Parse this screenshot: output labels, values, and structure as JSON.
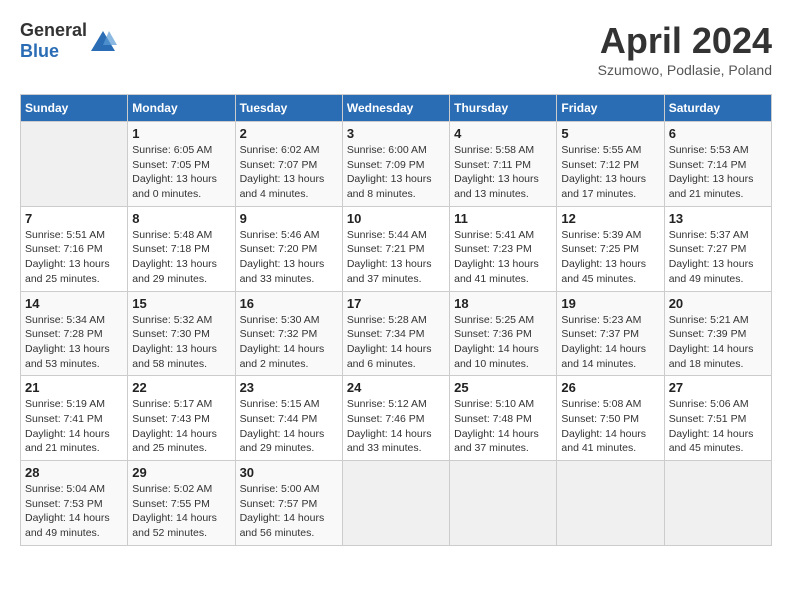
{
  "header": {
    "logo_general": "General",
    "logo_blue": "Blue",
    "title": "April 2024",
    "subtitle": "Szumowo, Podlasie, Poland"
  },
  "days_of_week": [
    "Sunday",
    "Monday",
    "Tuesday",
    "Wednesday",
    "Thursday",
    "Friday",
    "Saturday"
  ],
  "weeks": [
    [
      {
        "day": "",
        "info": ""
      },
      {
        "day": "1",
        "info": "Sunrise: 6:05 AM\nSunset: 7:05 PM\nDaylight: 13 hours\nand 0 minutes."
      },
      {
        "day": "2",
        "info": "Sunrise: 6:02 AM\nSunset: 7:07 PM\nDaylight: 13 hours\nand 4 minutes."
      },
      {
        "day": "3",
        "info": "Sunrise: 6:00 AM\nSunset: 7:09 PM\nDaylight: 13 hours\nand 8 minutes."
      },
      {
        "day": "4",
        "info": "Sunrise: 5:58 AM\nSunset: 7:11 PM\nDaylight: 13 hours\nand 13 minutes."
      },
      {
        "day": "5",
        "info": "Sunrise: 5:55 AM\nSunset: 7:12 PM\nDaylight: 13 hours\nand 17 minutes."
      },
      {
        "day": "6",
        "info": "Sunrise: 5:53 AM\nSunset: 7:14 PM\nDaylight: 13 hours\nand 21 minutes."
      }
    ],
    [
      {
        "day": "7",
        "info": "Sunrise: 5:51 AM\nSunset: 7:16 PM\nDaylight: 13 hours\nand 25 minutes."
      },
      {
        "day": "8",
        "info": "Sunrise: 5:48 AM\nSunset: 7:18 PM\nDaylight: 13 hours\nand 29 minutes."
      },
      {
        "day": "9",
        "info": "Sunrise: 5:46 AM\nSunset: 7:20 PM\nDaylight: 13 hours\nand 33 minutes."
      },
      {
        "day": "10",
        "info": "Sunrise: 5:44 AM\nSunset: 7:21 PM\nDaylight: 13 hours\nand 37 minutes."
      },
      {
        "day": "11",
        "info": "Sunrise: 5:41 AM\nSunset: 7:23 PM\nDaylight: 13 hours\nand 41 minutes."
      },
      {
        "day": "12",
        "info": "Sunrise: 5:39 AM\nSunset: 7:25 PM\nDaylight: 13 hours\nand 45 minutes."
      },
      {
        "day": "13",
        "info": "Sunrise: 5:37 AM\nSunset: 7:27 PM\nDaylight: 13 hours\nand 49 minutes."
      }
    ],
    [
      {
        "day": "14",
        "info": "Sunrise: 5:34 AM\nSunset: 7:28 PM\nDaylight: 13 hours\nand 53 minutes."
      },
      {
        "day": "15",
        "info": "Sunrise: 5:32 AM\nSunset: 7:30 PM\nDaylight: 13 hours\nand 58 minutes."
      },
      {
        "day": "16",
        "info": "Sunrise: 5:30 AM\nSunset: 7:32 PM\nDaylight: 14 hours\nand 2 minutes."
      },
      {
        "day": "17",
        "info": "Sunrise: 5:28 AM\nSunset: 7:34 PM\nDaylight: 14 hours\nand 6 minutes."
      },
      {
        "day": "18",
        "info": "Sunrise: 5:25 AM\nSunset: 7:36 PM\nDaylight: 14 hours\nand 10 minutes."
      },
      {
        "day": "19",
        "info": "Sunrise: 5:23 AM\nSunset: 7:37 PM\nDaylight: 14 hours\nand 14 minutes."
      },
      {
        "day": "20",
        "info": "Sunrise: 5:21 AM\nSunset: 7:39 PM\nDaylight: 14 hours\nand 18 minutes."
      }
    ],
    [
      {
        "day": "21",
        "info": "Sunrise: 5:19 AM\nSunset: 7:41 PM\nDaylight: 14 hours\nand 21 minutes."
      },
      {
        "day": "22",
        "info": "Sunrise: 5:17 AM\nSunset: 7:43 PM\nDaylight: 14 hours\nand 25 minutes."
      },
      {
        "day": "23",
        "info": "Sunrise: 5:15 AM\nSunset: 7:44 PM\nDaylight: 14 hours\nand 29 minutes."
      },
      {
        "day": "24",
        "info": "Sunrise: 5:12 AM\nSunset: 7:46 PM\nDaylight: 14 hours\nand 33 minutes."
      },
      {
        "day": "25",
        "info": "Sunrise: 5:10 AM\nSunset: 7:48 PM\nDaylight: 14 hours\nand 37 minutes."
      },
      {
        "day": "26",
        "info": "Sunrise: 5:08 AM\nSunset: 7:50 PM\nDaylight: 14 hours\nand 41 minutes."
      },
      {
        "day": "27",
        "info": "Sunrise: 5:06 AM\nSunset: 7:51 PM\nDaylight: 14 hours\nand 45 minutes."
      }
    ],
    [
      {
        "day": "28",
        "info": "Sunrise: 5:04 AM\nSunset: 7:53 PM\nDaylight: 14 hours\nand 49 minutes."
      },
      {
        "day": "29",
        "info": "Sunrise: 5:02 AM\nSunset: 7:55 PM\nDaylight: 14 hours\nand 52 minutes."
      },
      {
        "day": "30",
        "info": "Sunrise: 5:00 AM\nSunset: 7:57 PM\nDaylight: 14 hours\nand 56 minutes."
      },
      {
        "day": "",
        "info": ""
      },
      {
        "day": "",
        "info": ""
      },
      {
        "day": "",
        "info": ""
      },
      {
        "day": "",
        "info": ""
      }
    ]
  ]
}
